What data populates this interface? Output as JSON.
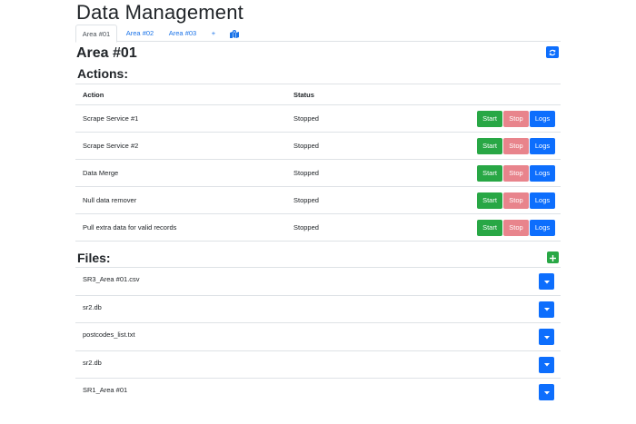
{
  "page": {
    "title": "Data Management"
  },
  "tabs": [
    {
      "label": "Area #01",
      "active": true
    },
    {
      "label": "Area #02",
      "active": false
    },
    {
      "label": "Area #03",
      "active": false
    },
    {
      "label": "+",
      "active": false
    }
  ],
  "area": {
    "title": "Area #01"
  },
  "actions": {
    "section_title": "Actions:",
    "columns": [
      "Action",
      "Status"
    ],
    "button_labels": {
      "start": "Start",
      "stop": "Stop",
      "logs": "Logs"
    },
    "rows": [
      {
        "action": "Scrape Service #1",
        "status": "Stopped"
      },
      {
        "action": "Scrape Service #2",
        "status": "Stopped"
      },
      {
        "action": "Data Merge",
        "status": "Stopped"
      },
      {
        "action": "Null data remover",
        "status": "Stopped"
      },
      {
        "action": "Pull extra data for valid records",
        "status": "Stopped"
      }
    ]
  },
  "files": {
    "section_title": "Files:",
    "items": [
      "SR3_Area #01.csv",
      "sr2.db",
      "postcodes_list.txt",
      "sr2.db",
      "SR1_Area #01"
    ]
  },
  "icons": {
    "map_tab": "map-marked-icon",
    "refresh": "sync-icon",
    "add_file": "plus-icon",
    "file_menu": "caret-down-icon"
  },
  "colors": {
    "primary": "#0d6efd",
    "success": "#28a745",
    "danger_muted": "#e8848c"
  }
}
